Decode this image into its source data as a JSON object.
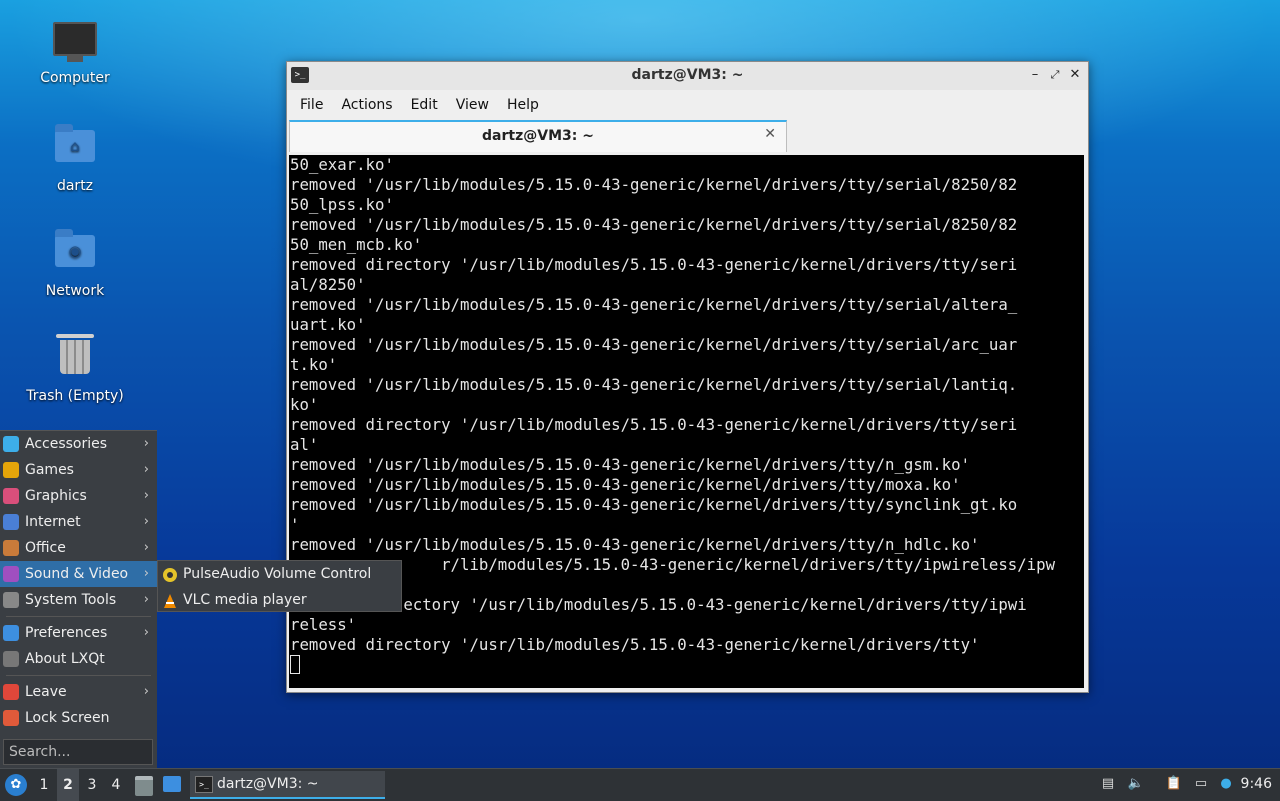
{
  "desktop": {
    "icons": [
      {
        "label": "Computer"
      },
      {
        "label": "dartz"
      },
      {
        "label": "Network"
      },
      {
        "label": "Trash (Empty)"
      }
    ]
  },
  "terminal": {
    "window_title": "dartz@VM3: ~",
    "menus": [
      "File",
      "Actions",
      "Edit",
      "View",
      "Help"
    ],
    "tab_label": "dartz@VM3: ~",
    "lines": [
      "50_exar.ko'",
      "removed '/usr/lib/modules/5.15.0-43-generic/kernel/drivers/tty/serial/8250/82",
      "50_lpss.ko'",
      "removed '/usr/lib/modules/5.15.0-43-generic/kernel/drivers/tty/serial/8250/82",
      "50_men_mcb.ko'",
      "removed directory '/usr/lib/modules/5.15.0-43-generic/kernel/drivers/tty/seri",
      "al/8250'",
      "removed '/usr/lib/modules/5.15.0-43-generic/kernel/drivers/tty/serial/altera_",
      "uart.ko'",
      "removed '/usr/lib/modules/5.15.0-43-generic/kernel/drivers/tty/serial/arc_uar",
      "t.ko'",
      "removed '/usr/lib/modules/5.15.0-43-generic/kernel/drivers/tty/serial/lantiq.",
      "ko'",
      "removed directory '/usr/lib/modules/5.15.0-43-generic/kernel/drivers/tty/seri",
      "al'",
      "removed '/usr/lib/modules/5.15.0-43-generic/kernel/drivers/tty/n_gsm.ko'",
      "removed '/usr/lib/modules/5.15.0-43-generic/kernel/drivers/tty/moxa.ko'",
      "removed '/usr/lib/modules/5.15.0-43-generic/kernel/drivers/tty/synclink_gt.ko",
      "'",
      "removed '/usr/lib/modules/5.15.0-43-generic/kernel/drivers/tty/n_hdlc.ko'",
      "                r/lib/modules/5.15.0-43-generic/kernel/drivers/tty/ipwireless/ipw",
      "",
      "            ectory '/usr/lib/modules/5.15.0-43-generic/kernel/drivers/tty/ipwi",
      "reless'",
      "removed directory '/usr/lib/modules/5.15.0-43-generic/kernel/drivers/tty'"
    ]
  },
  "start_menu": {
    "items": [
      {
        "label": "Accessories",
        "color": "#3daee9"
      },
      {
        "label": "Games",
        "color": "#e5a50a"
      },
      {
        "label": "Graphics",
        "color": "#d94f7b"
      },
      {
        "label": "Internet",
        "color": "#4a7fd6"
      },
      {
        "label": "Office",
        "color": "#c97b3a"
      },
      {
        "label": "Sound & Video",
        "color": "#a04fc0"
      },
      {
        "label": "System Tools",
        "color": "#888888"
      },
      {
        "label": "Preferences",
        "color": "#3d8fe0"
      },
      {
        "label": "About LXQt",
        "color": "#777777"
      },
      {
        "label": "Leave",
        "color": "#e0473a"
      },
      {
        "label": "Lock Screen",
        "color": "#e05a3a"
      }
    ],
    "search_placeholder": "Search...",
    "submenu": [
      {
        "label": "PulseAudio Volume Control"
      },
      {
        "label": "VLC media player"
      }
    ]
  },
  "taskbar": {
    "workspaces": [
      "1",
      "2",
      "3",
      "4"
    ],
    "current_workspace": "2",
    "task_label": "dartz@VM3: ~",
    "clock": "9:46"
  }
}
